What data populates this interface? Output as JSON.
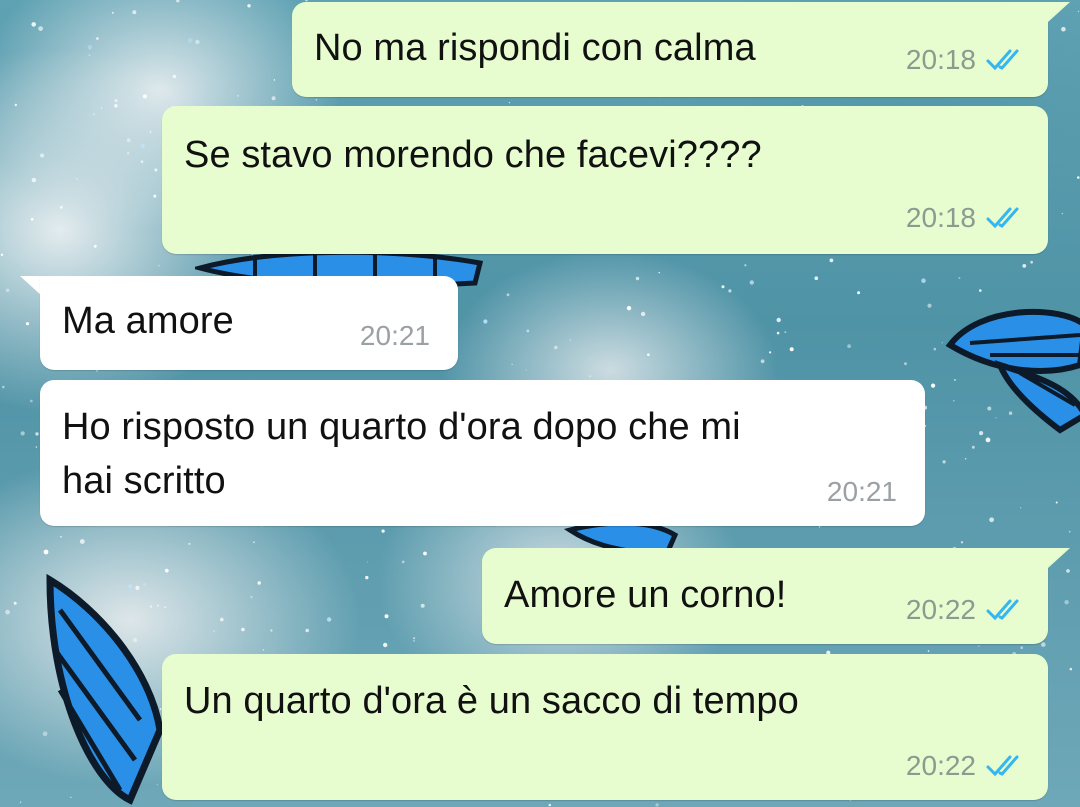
{
  "colors": {
    "outgoing_bubble": "#e7fdd0",
    "incoming_bubble": "#ffffff",
    "read_tick": "#34b7f1",
    "wallpaper_teal": "#5fa2b3",
    "butterfly_blue": "#2a8fe6"
  },
  "icons": {
    "read_receipt": "double-check-icon"
  },
  "messages": [
    {
      "direction": "out",
      "text": "No ma rispondi con calma",
      "time": "20:18",
      "status": "read"
    },
    {
      "direction": "out",
      "text": "Se stavo morendo che facevi????",
      "time": "20:18",
      "status": "read"
    },
    {
      "direction": "in",
      "text": "Ma amore",
      "time": "20:21"
    },
    {
      "direction": "in",
      "text": "Ho risposto un quarto d'ora dopo che mi\nhai scritto",
      "time": "20:21"
    },
    {
      "direction": "out",
      "text": "Amore un corno!",
      "time": "20:22",
      "status": "read"
    },
    {
      "direction": "out",
      "text": "Un quarto d'ora è un sacco di tempo",
      "time": "20:22",
      "status": "read"
    }
  ]
}
